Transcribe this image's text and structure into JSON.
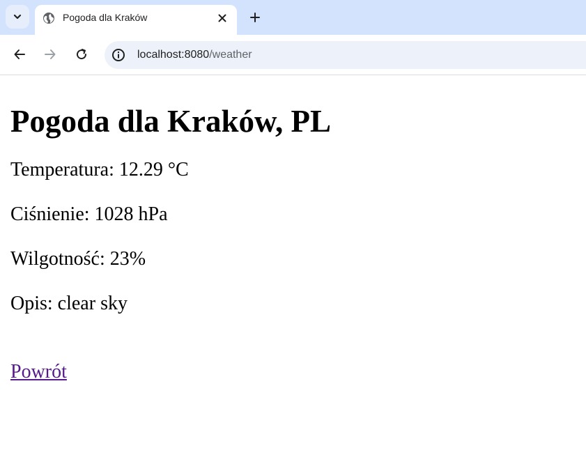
{
  "browser": {
    "tab": {
      "title": "Pogoda dla Kraków",
      "favicon": "globe-icon"
    },
    "url": {
      "host": "localhost:8080",
      "path": "/weather"
    },
    "colors": {
      "tabstrip": "#d3e3fd",
      "omnibox": "#edf2fa"
    }
  },
  "page": {
    "heading": "Pogoda dla Kraków, PL",
    "temperature": "Temperatura: 12.29 °C",
    "pressure": "Ciśnienie: 1028 hPa",
    "humidity": "Wilgotność: 23%",
    "description": "Opis: clear sky",
    "back_link": "Powrót",
    "link_color": "#551a8b"
  }
}
